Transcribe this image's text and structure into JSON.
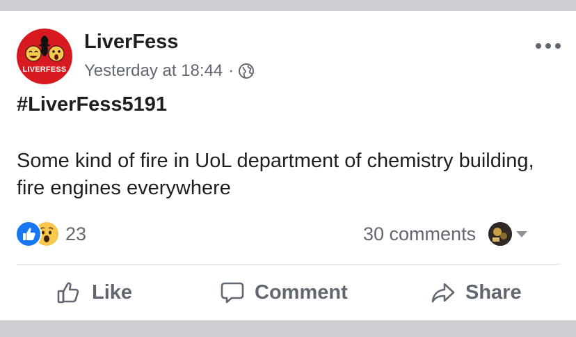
{
  "post": {
    "page_name": "LiverFess",
    "avatar_text": "LIVERFESS",
    "timestamp": "Yesterday at 18:44",
    "separator": "·",
    "privacy_icon": "globe-icon",
    "hashtag": "#LiverFess5191",
    "body": "Some kind of fire in UoL department of chemistry building, fire engines everywhere",
    "reactions": {
      "icons": [
        "like-icon",
        "wow-icon"
      ],
      "count": "23"
    },
    "comments_count": "30 comments",
    "actions": {
      "like": "Like",
      "comment": "Comment",
      "share": "Share"
    }
  },
  "colors": {
    "text_primary": "#1c1e21",
    "text_secondary": "#616770",
    "like_blue": "#1877f2",
    "wow_yellow": "#f7c84b",
    "avatar_red": "#d71920",
    "separator_band": "#cdced2"
  }
}
